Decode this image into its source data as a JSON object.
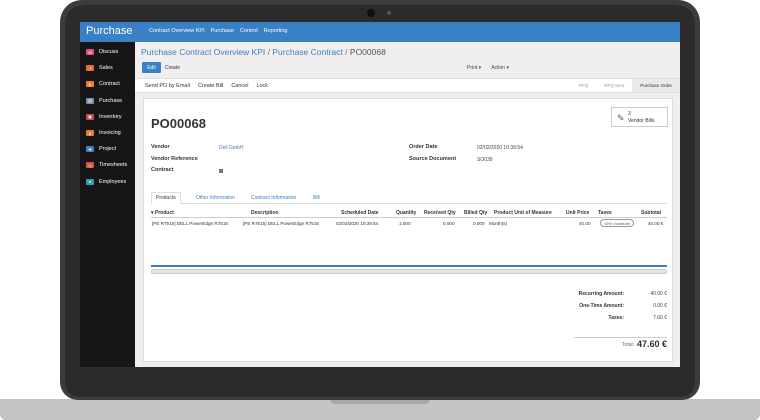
{
  "app": {
    "title": "Purchase"
  },
  "top_menu": [
    "Contract Overview KPI",
    "Purchase",
    "Control",
    "Reporting"
  ],
  "sidebar": {
    "items": [
      {
        "label": "Discuss",
        "color": "#e0537a"
      },
      {
        "label": "Sales",
        "color": "#e06d3c"
      },
      {
        "label": "Contract",
        "color": "#f07e29"
      },
      {
        "label": "Purchase",
        "color": "#7c8fad"
      },
      {
        "label": "Inventory",
        "color": "#c0504d"
      },
      {
        "label": "Invoicing",
        "color": "#e07c3c"
      },
      {
        "label": "Project",
        "color": "#4a7cc0"
      },
      {
        "label": "Timesheets",
        "color": "#d9534f"
      },
      {
        "label": "Employees",
        "color": "#3d9bb0"
      }
    ]
  },
  "breadcrumb": {
    "part1": "Purchase Contract Overview KPI",
    "sep1": "/",
    "part2": "Purchase Contract",
    "sep2": "/",
    "current": "PO00068"
  },
  "toolbar": {
    "edit_label": "Edit",
    "create_label": "Create",
    "print_label": "Print ▾",
    "action_label": "Action ▾"
  },
  "actions": [
    "Send PO by Email",
    "Create Bill",
    "Cancel",
    "Lock"
  ],
  "stages": [
    {
      "label": "RFQ",
      "active": false
    },
    {
      "label": "RFQ Sent",
      "active": false
    },
    {
      "label": "Purchase Order",
      "active": true
    }
  ],
  "record": {
    "name": "PO00068",
    "smart_button": {
      "count": "3",
      "label": "Vendor Bills"
    },
    "fields": {
      "vendor_label": "Vendor",
      "vendor_value": "Dell GmbH",
      "vendor_ref_label": "Vendor Reference",
      "contract_label": "Contract",
      "order_date_label": "Order Date",
      "order_date_value": "02/02/2020 10:39:54",
      "source_doc_label": "Source Document",
      "source_doc_value": "SO039"
    }
  },
  "tabs": [
    "Products",
    "Other Information",
    "Contract Information",
    "Bill"
  ],
  "table": {
    "columns": [
      "▾ Product",
      "Description",
      "Scheduled Date",
      "Quantity",
      "Received Qty",
      "Billed Qty",
      "Product Unit of Measure",
      "Unit Price",
      "Taxes",
      "Subtotal"
    ],
    "rows": [
      {
        "product": "[PE R7515] DELL PowerEdge R7515",
        "description": "[PE R7515] DELL PowerEdge R7515",
        "scheduled": "02/03/2020 10:39:54",
        "quantity": "1.000",
        "received": "0.000",
        "billed": "0.000",
        "uom": "Month(s)",
        "unit_price": "40.00",
        "taxes": "19% Vorsteuer",
        "subtotal": "40.00 €"
      }
    ]
  },
  "totals": {
    "recurring_label": "Recurring Amount:",
    "recurring_value": "40.00 €",
    "onetime_label": "One-Time Amount:",
    "onetime_value": "0.00 €",
    "taxes_label": "Taxes:",
    "taxes_value": "7.60 €",
    "total_label": "Total:",
    "total_value": "47.60 €"
  }
}
